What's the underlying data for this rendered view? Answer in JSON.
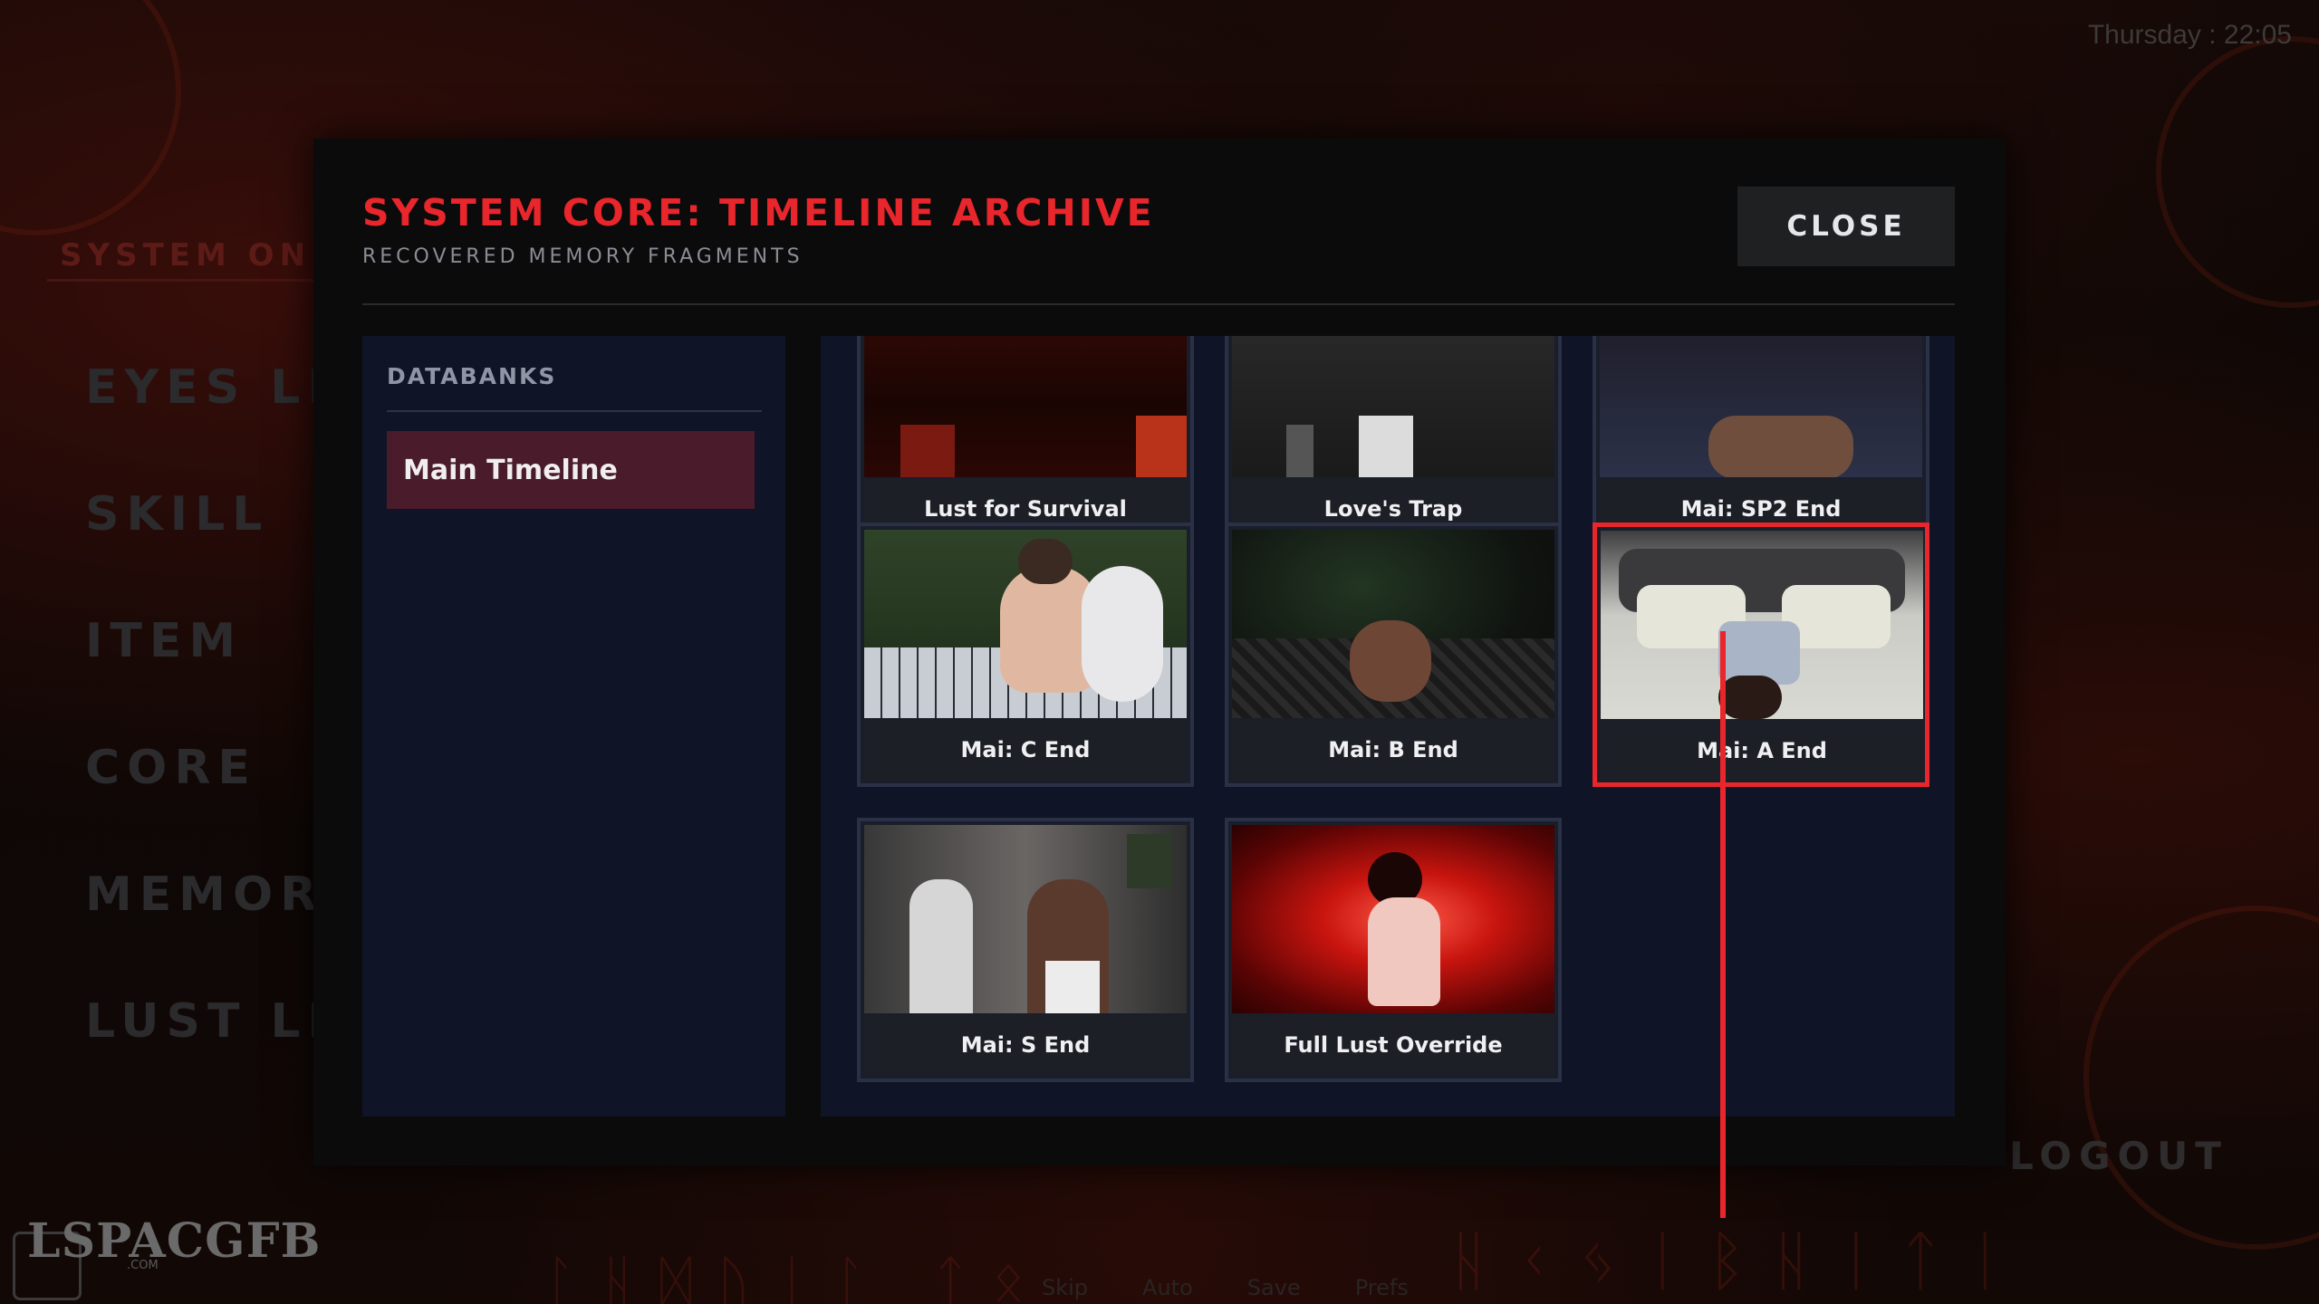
{
  "clock": "Thursday : 22:05",
  "side_menu": {
    "status": "SYSTEM ONLIN",
    "items": [
      "EYES LIN",
      "SKILL",
      "ITEM",
      "CORE",
      "MEMORY",
      "LUST LIN"
    ],
    "logout": "LOGOUT"
  },
  "bottom_bar": [
    "Skip",
    "Auto",
    "Save",
    "Prefs"
  ],
  "watermark": {
    "main": "LSPACGFB",
    "sub": ".COM"
  },
  "modal": {
    "title": "SYSTEM CORE: TIMELINE ARCHIVE",
    "subtitle": "RECOVERED MEMORY FRAGMENTS",
    "close_label": "CLOSE"
  },
  "databanks": {
    "label": "DATABANKS",
    "items": [
      "Main Timeline"
    ],
    "selected": "Main Timeline"
  },
  "gallery": {
    "cards": [
      {
        "title": "Lust for Survival"
      },
      {
        "title": "Love's Trap"
      },
      {
        "title": "Mai: SP2 End"
      },
      {
        "title": "Mai: C End"
      },
      {
        "title": "Mai: B End"
      },
      {
        "title": "Mai: A End"
      },
      {
        "title": "Mai: S End"
      },
      {
        "title": "Full Lust Override"
      }
    ],
    "selected": "Mai: A End"
  },
  "colors": {
    "accent": "#e8262b",
    "panel": "#0f1526",
    "selected_bank": "#4a1b2b"
  }
}
